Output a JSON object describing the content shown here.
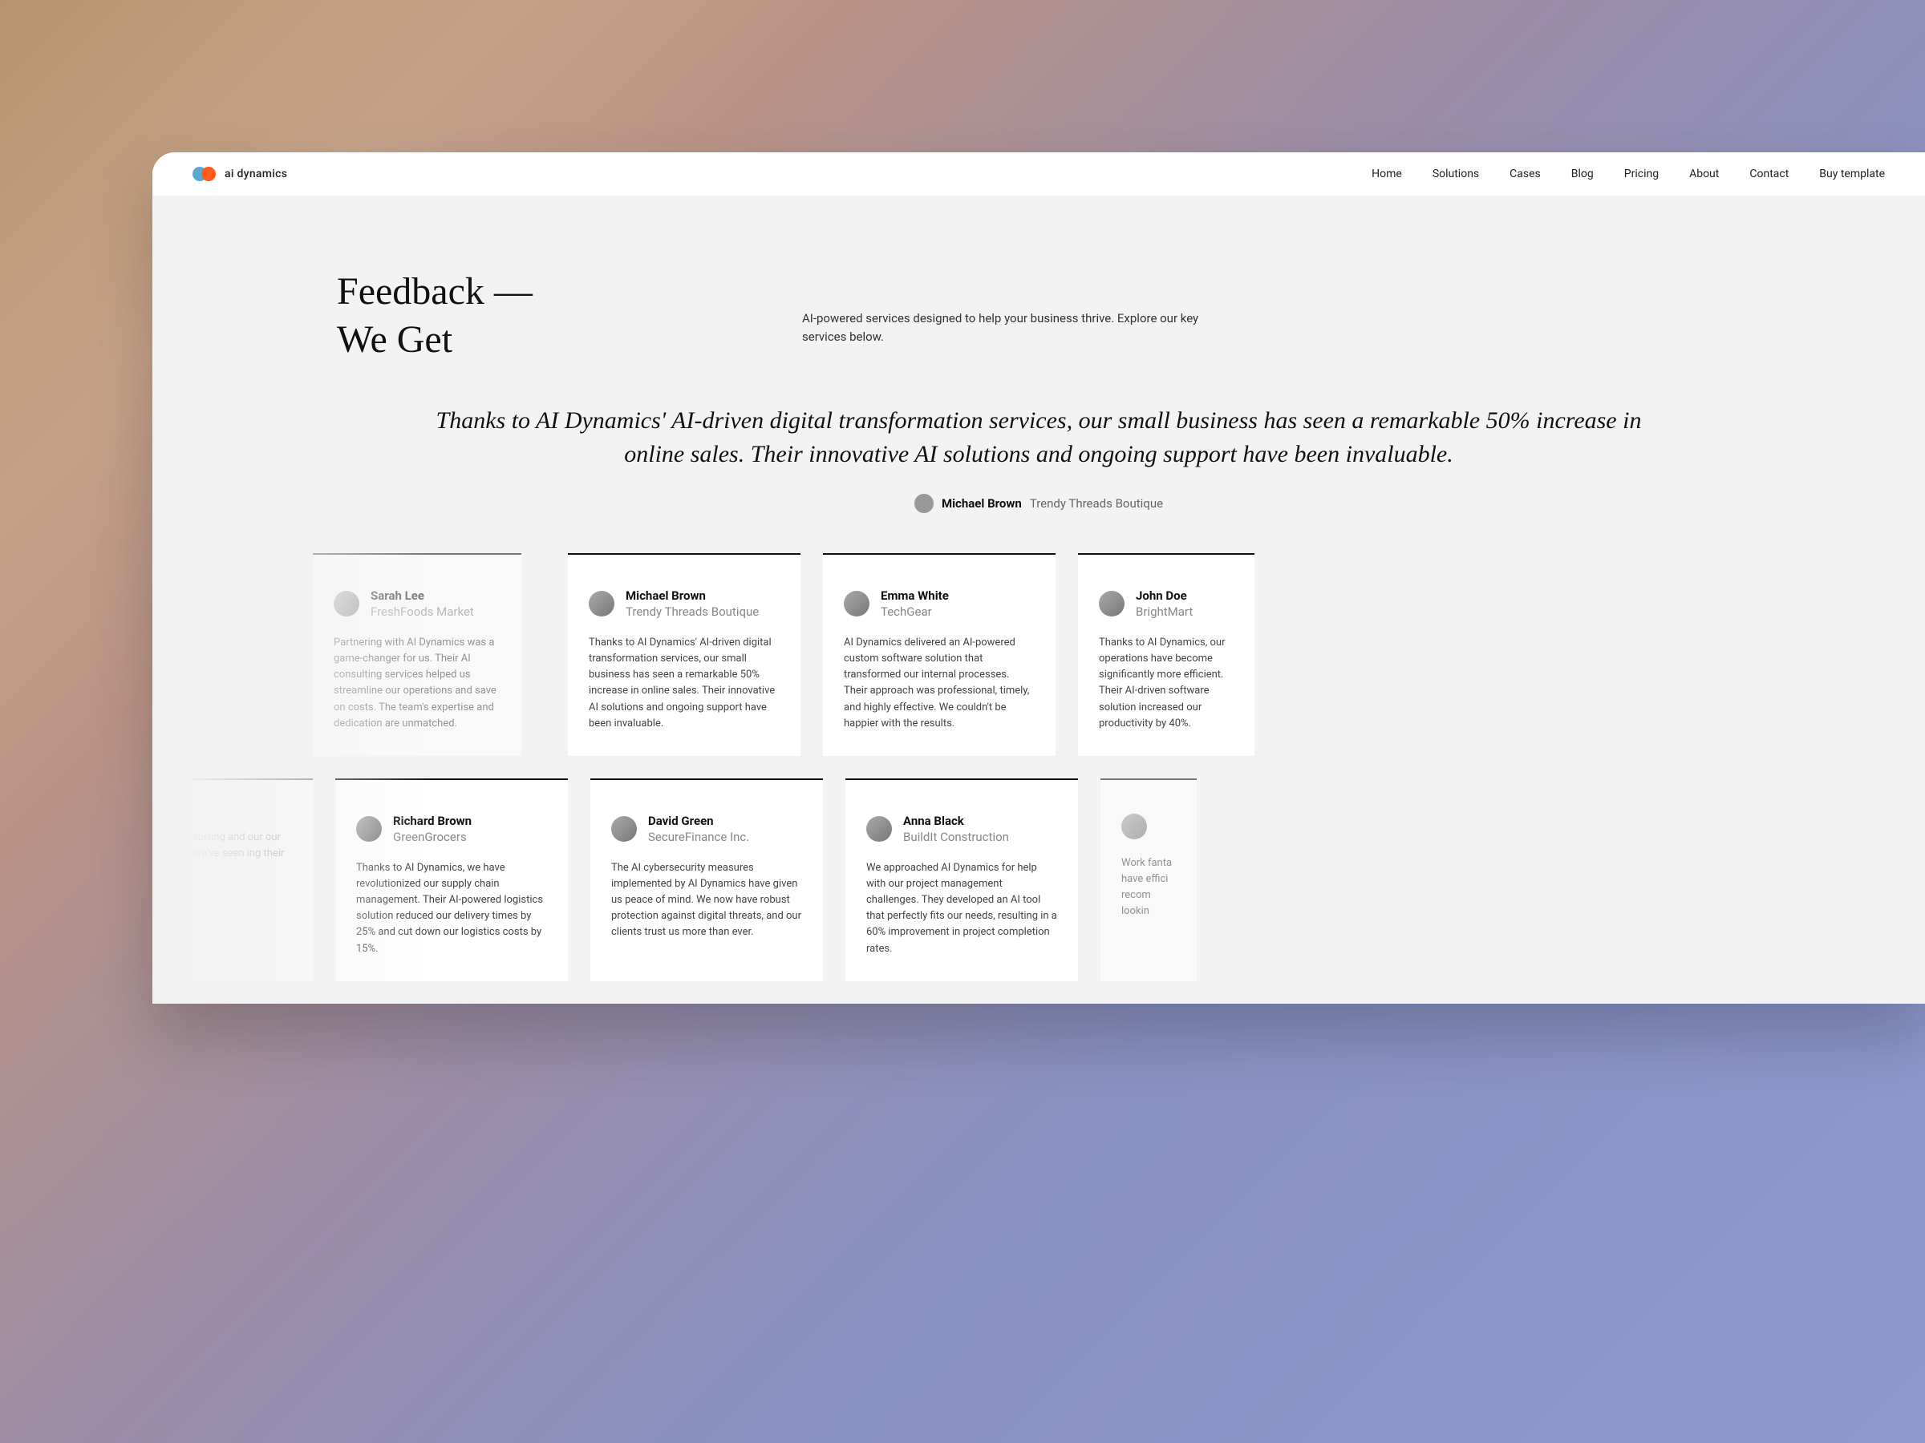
{
  "brand": {
    "name": "ai dynamics"
  },
  "nav": {
    "home": "Home",
    "solutions": "Solutions",
    "cases": "Cases",
    "blog": "Blog",
    "pricing": "Pricing",
    "about": "About",
    "contact": "Contact",
    "buy": "Buy template"
  },
  "header": {
    "title_line1": "Feedback —",
    "title_line2": "We Get",
    "subheading": "AI-powered services designed to help your business thrive. Explore our key services below."
  },
  "featured": {
    "quote": "Thanks to AI Dynamics' AI-driven digital transformation services, our small business has seen a remarkable 50% increase in online sales. Their innovative AI solutions and ongoing support have been invaluable.",
    "author_name": "Michael Brown",
    "author_company": "Trendy Threads Boutique"
  },
  "row1": [
    {
      "name": "Sarah Lee",
      "company": "FreshFoods Market",
      "body": "Partnering with AI Dynamics was a game-changer for us. Their AI consulting services helped us streamline our operations and save on costs. The team's expertise and dedication are unmatched."
    },
    {
      "name": "Michael Brown",
      "company": "Trendy Threads Boutique",
      "body": "Thanks to AI Dynamics' AI-driven digital transformation services, our small business has seen a remarkable 50% increase in online sales. Their innovative AI solutions and ongoing support have been invaluable."
    },
    {
      "name": "Emma White",
      "company": "TechGear",
      "body": "AI Dynamics delivered an AI-powered custom software solution that transformed our internal processes. Their approach was professional, timely, and highly effective. We couldn't be happier with the results."
    },
    {
      "name": "John Doe",
      "company": "BrightMart",
      "body": "Thanks to AI Dynamics, our operations have become significantly more efficient. Their AI-driven software solution increased our productivity by 40%."
    }
  ],
  "row2": [
    {
      "name": "",
      "company": "",
      "body": "sorting and our our We've seen ing their"
    },
    {
      "name": "Richard Brown",
      "company": "GreenGrocers",
      "body": "Thanks to AI Dynamics, we have revolutionized our supply chain management. Their AI-powered logistics solution reduced our delivery times by 25% and cut down our logistics costs by 15%."
    },
    {
      "name": "David Green",
      "company": "SecureFinance Inc.",
      "body": "The AI cybersecurity measures implemented by AI Dynamics have given us peace of mind. We now have robust protection against digital threats, and our clients trust us more than ever."
    },
    {
      "name": "Anna Black",
      "company": "BuildIt Construction",
      "body": "We approached AI Dynamics for help with our project management challenges. They developed an AI tool that perfectly fits our needs, resulting in a 60% improvement in project completion rates."
    },
    {
      "name": "",
      "company": "",
      "body": "Work fanta have effici recom lookin"
    }
  ]
}
